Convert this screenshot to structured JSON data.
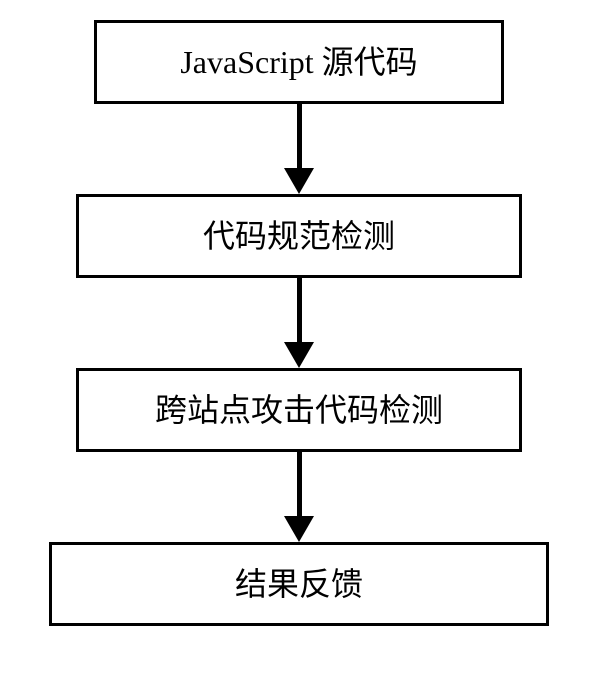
{
  "flowchart": {
    "steps": [
      {
        "label": "JavaScript 源代码"
      },
      {
        "label": "代码规范检测"
      },
      {
        "label": "跨站点攻击代码检测"
      },
      {
        "label": "结果反馈"
      }
    ]
  }
}
